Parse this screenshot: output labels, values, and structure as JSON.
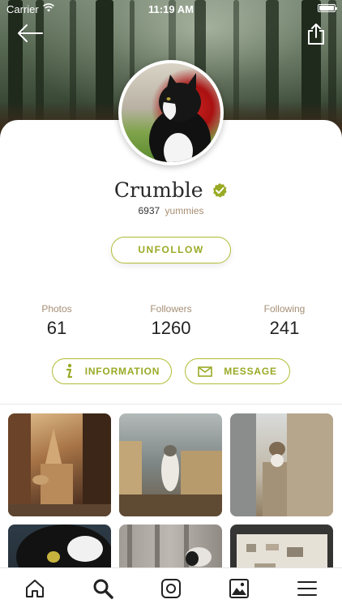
{
  "status_bar": {
    "carrier": "Carrier",
    "time": "11:19 AM"
  },
  "profile": {
    "name": "Crumble",
    "verified": true,
    "yummies_count": "6937",
    "yummies_label": "yummies",
    "unfollow_label": "UNFOLLOW"
  },
  "stats": [
    {
      "label": "Photos",
      "value": "61"
    },
    {
      "label": "Followers",
      "value": "1260"
    },
    {
      "label": "Following",
      "value": "241"
    }
  ],
  "actions": {
    "information_label": "INFORMATION",
    "message_label": "MESSAGE"
  },
  "tabbar": [
    "home-icon",
    "search-icon",
    "instagram-icon",
    "gallery-icon",
    "menu-icon"
  ],
  "colors": {
    "accent": "#9aaa25",
    "accent_border": "#b0bc35",
    "muted_label": "#a58f75"
  }
}
